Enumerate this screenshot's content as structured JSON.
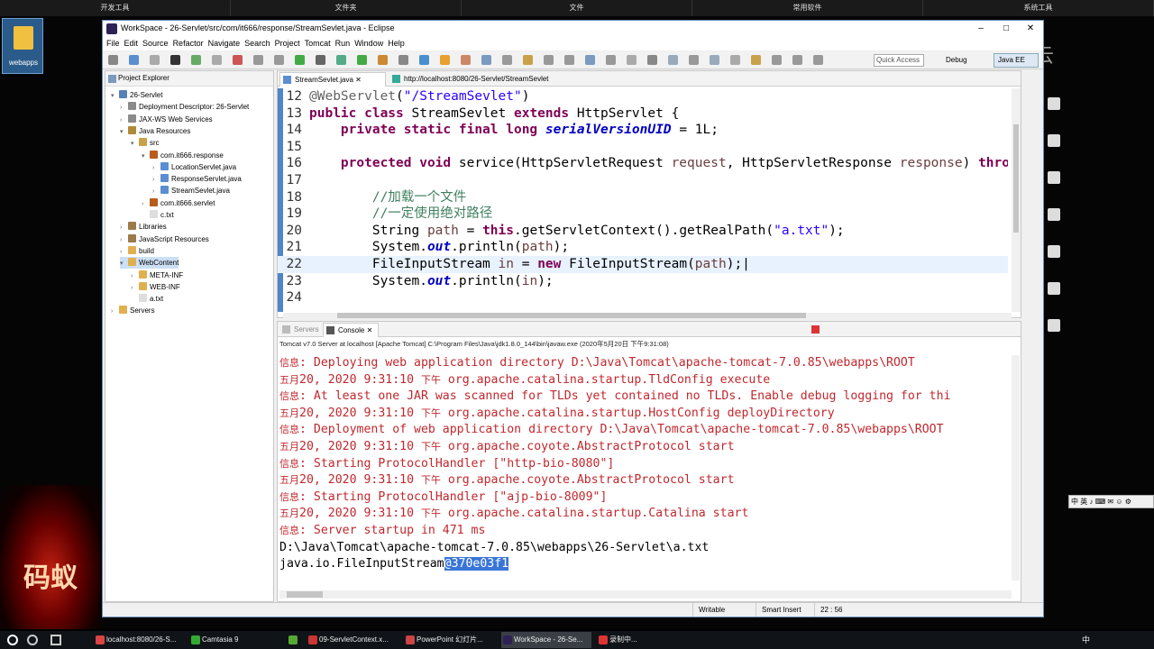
{
  "topbar": [
    "开发工具",
    "文件夹",
    "文件",
    "常用软件",
    "系统工具"
  ],
  "desktop_icon": "webapps",
  "logo_text": "码蚁",
  "watermark": "网易云",
  "window_title": "WorkSpace - 26-Servlet/src/com/it666/response/StreamSevlet.java - Eclipse",
  "menu": [
    "File",
    "Edit",
    "Source",
    "Refactor",
    "Navigate",
    "Search",
    "Project",
    "Tomcat",
    "Run",
    "Window",
    "Help"
  ],
  "quick_access": "Quick Access",
  "perspectives": {
    "debug": "Debug",
    "javaee": "Java EE"
  },
  "explorer": {
    "title": "Project Explorer",
    "items": [
      {
        "label": "26-Servlet",
        "arrow": "▾",
        "icon": "#5a7fb5"
      },
      {
        "label": "Deployment Descriptor: 26-Servlet",
        "arrow": "›",
        "icon": "#8a8a8a"
      },
      {
        "label": "JAX-WS Web Services",
        "arrow": "›",
        "icon": "#8a8a8a"
      },
      {
        "label": "Java Resources",
        "arrow": "▾",
        "icon": "#b08a3a"
      },
      {
        "label": "src",
        "arrow": "▾",
        "icon": "#c9a14a"
      },
      {
        "label": "com.it666.response",
        "arrow": "▾",
        "icon": "#b85c1e"
      },
      {
        "label": "LocationServlet.java",
        "arrow": "›",
        "icon": "#5a8ed0"
      },
      {
        "label": "ResponseServlet.java",
        "arrow": "›",
        "icon": "#5a8ed0"
      },
      {
        "label": "StreamSevlet.java",
        "arrow": "›",
        "icon": "#5a8ed0"
      },
      {
        "label": "com.it666.servlet",
        "arrow": "›",
        "icon": "#b85c1e"
      },
      {
        "label": "c.txt",
        "arrow": "",
        "icon": "#ddd"
      },
      {
        "label": "Libraries",
        "arrow": "›",
        "icon": "#9c7a4a"
      },
      {
        "label": "JavaScript Resources",
        "arrow": "›",
        "icon": "#9c7a4a"
      },
      {
        "label": "build",
        "arrow": "›",
        "icon": "#e0b050"
      },
      {
        "label": "WebContent",
        "arrow": "▾",
        "icon": "#e0b050"
      },
      {
        "label": "META-INF",
        "arrow": "›",
        "icon": "#e0b050"
      },
      {
        "label": "WEB-INF",
        "arrow": "›",
        "icon": "#e0b050"
      },
      {
        "label": "a.txt",
        "arrow": "",
        "icon": "#ddd"
      },
      {
        "label": "Servers",
        "arrow": "›",
        "icon": "#e0b050"
      }
    ]
  },
  "editor": {
    "tabs": [
      "StreamSevlet.java",
      "http://localhost:8080/26-Servlet/StreamSevlet"
    ],
    "lines": [
      {
        "n": "12",
        "html": "<span class=\"ann\">@WebServlet</span>(<span class=\"str\">\"/StreamSevlet\"</span>)"
      },
      {
        "n": "13",
        "html": "<span class=\"kw\">public class</span> StreamSevlet <span class=\"kw\">extends</span> HttpServlet {"
      },
      {
        "n": "14",
        "html": "    <span class=\"kw\">private static final long</span> <span class=\"fld\">serialVersionUID</span> = 1L;"
      },
      {
        "n": "15",
        "html": ""
      },
      {
        "n": "16",
        "html": "    <span class=\"kw\">protected void</span> service(HttpServletRequest <span class=\"par\">request</span>, HttpServletResponse <span class=\"par\">response</span>) <span class=\"kw\">thro</span>"
      },
      {
        "n": "17",
        "html": ""
      },
      {
        "n": "18",
        "html": "        <span class=\"cm\">//加载一个文件</span>"
      },
      {
        "n": "19",
        "html": "        <span class=\"cm\">//一定使用绝对路径</span>"
      },
      {
        "n": "20",
        "html": "        String <span class=\"par\">path</span> = <span class=\"kw\">this</span>.getServletContext().getRealPath(<span class=\"str\">\"a.txt\"</span>);"
      },
      {
        "n": "21",
        "html": "        System.<span class=\"fld\">out</span>.println(<span class=\"par\">path</span>);"
      },
      {
        "n": "22",
        "html": "        FileInputStream <span class=\"par\">in</span> = <span class=\"kw\">new</span> FileInputStream(<span class=\"par\">path</span>);|"
      },
      {
        "n": "23",
        "html": "        System.<span class=\"fld\">out</span>.println(<span class=\"par\">in</span>);"
      },
      {
        "n": "24",
        "html": ""
      }
    ]
  },
  "console": {
    "tabs": [
      "Servers",
      "Console"
    ],
    "path": "Tomcat v7.0 Server at localhost [Apache Tomcat] C:\\Program Files\\Java\\jdk1.8.0_144\\bin\\javaw.exe (2020年5月20日 下午9:31:08)",
    "lines": [
      {
        "cls": "",
        "html": "<span class=\"cjk\">信息</span>: Deploying web application directory D:\\Java\\Tomcat\\apache-tomcat-7.0.85\\webapps\\ROOT"
      },
      {
        "cls": "",
        "html": "<span class=\"cjk\">五月</span>20, 2020 9:31:10 <span class=\"cjk\">下午</span> org.apache.catalina.startup.TldConfig execute"
      },
      {
        "cls": "",
        "html": "<span class=\"cjk\">信息</span>: At least one JAR was scanned for TLDs yet contained no TLDs. Enable debug logging for thi"
      },
      {
        "cls": "",
        "html": "<span class=\"cjk\">五月</span>20, 2020 9:31:10 <span class=\"cjk\">下午</span> org.apache.catalina.startup.HostConfig deployDirectory"
      },
      {
        "cls": "",
        "html": "<span class=\"cjk\">信息</span>: Deployment of web application directory D:\\Java\\Tomcat\\apache-tomcat-7.0.85\\webapps\\ROOT"
      },
      {
        "cls": "",
        "html": "<span class=\"cjk\">五月</span>20, 2020 9:31:10 <span class=\"cjk\">下午</span> org.apache.coyote.AbstractProtocol start"
      },
      {
        "cls": "",
        "html": "<span class=\"cjk\">信息</span>: Starting ProtocolHandler [\"http-bio-8080\"]"
      },
      {
        "cls": "",
        "html": "<span class=\"cjk\">五月</span>20, 2020 9:31:10 <span class=\"cjk\">下午</span> org.apache.coyote.AbstractProtocol start"
      },
      {
        "cls": "",
        "html": "<span class=\"cjk\">信息</span>: Starting ProtocolHandler [\"ajp-bio-8009\"]"
      },
      {
        "cls": "",
        "html": "<span class=\"cjk\">五月</span>20, 2020 9:31:10 <span class=\"cjk\">下午</span> org.apache.catalina.startup.Catalina start"
      },
      {
        "cls": "",
        "html": "<span class=\"cjk\">信息</span>: Server startup in 471 ms"
      },
      {
        "cls": "out",
        "html": "D:\\Java\\Tomcat\\apache-tomcat-7.0.85\\webapps\\26-Servlet\\a.txt"
      },
      {
        "cls": "out",
        "html": "java.io.FileInputStream<span class=\"hl\">@370e03f1</span>"
      }
    ]
  },
  "status": {
    "mode": "Writable",
    "insert": "Smart Insert",
    "pos": "22 : 56"
  },
  "taskbar": [
    {
      "label": "localhost:8080/26-S...",
      "color": "#d44",
      "active": false
    },
    {
      "label": "Camtasia 9",
      "color": "#3a3",
      "active": false
    },
    {
      "label": "",
      "color": "#5a3",
      "active": false
    },
    {
      "label": "09-ServletContext.x...",
      "color": "#c33",
      "active": false
    },
    {
      "label": "PowerPoint 幻灯片...",
      "color": "#c44",
      "active": false
    },
    {
      "label": "WorkSpace - 26-Se...",
      "color": "#2c2255",
      "active": true
    },
    {
      "label": "录制中...",
      "color": "#d33",
      "active": false
    }
  ],
  "tray": "中"
}
